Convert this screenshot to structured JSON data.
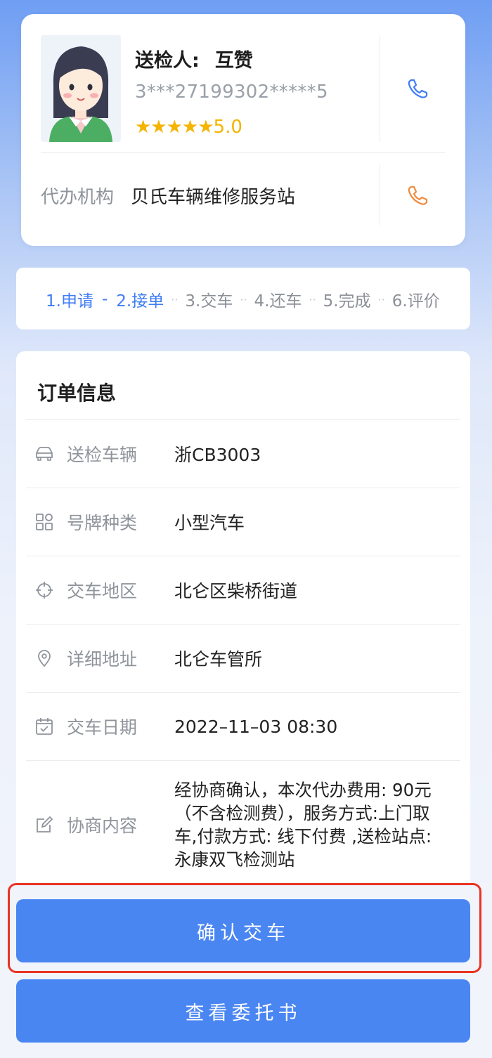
{
  "sender": {
    "label": "送检人:",
    "name": "互赞",
    "id_masked": "3***27199302*****5",
    "stars": "★★★★★",
    "rating": "5.0"
  },
  "agency": {
    "label": "代办机构",
    "name": "贝氏车辆维修服务站"
  },
  "steps": [
    {
      "label": "1.申请",
      "active": true
    },
    {
      "label": "2.接单",
      "active": true
    },
    {
      "label": "3.交车",
      "active": false
    },
    {
      "label": "4.还车",
      "active": false
    },
    {
      "label": "5.完成",
      "active": false
    },
    {
      "label": "6.评价",
      "active": false
    }
  ],
  "step_separators": {
    "active": "-",
    "inactive": "··"
  },
  "order": {
    "title": "订单信息",
    "rows": [
      {
        "icon": "car-icon",
        "label": "送检车辆",
        "value": "浙CB3003"
      },
      {
        "icon": "grid-icon",
        "label": "号牌种类",
        "value": "小型汽车"
      },
      {
        "icon": "crosshair-icon",
        "label": "交车地区",
        "value": "北仑区柴桥街道"
      },
      {
        "icon": "location-pin-icon",
        "label": "详细地址",
        "value": "北仑车管所"
      },
      {
        "icon": "calendar-icon",
        "label": "交车日期",
        "value": "2022–11–03 08:30"
      },
      {
        "icon": "edit-icon",
        "label": "协商内容",
        "value": "经协商确认，本次代办费用: 90元（不含检测费），服务方式:上门取车,付款方式: 线下付费 ,送检站点: 永康双飞检测站"
      }
    ]
  },
  "buttons": {
    "confirm": "确认交车",
    "view_letter": "查看委托书"
  },
  "colors": {
    "accent": "#4a86f2",
    "active_step": "#3f7cf5",
    "star": "#f4b400",
    "phone_orange": "#f08a3c",
    "phone_blue": "#3f7cf5",
    "highlight": "#ea3323"
  }
}
